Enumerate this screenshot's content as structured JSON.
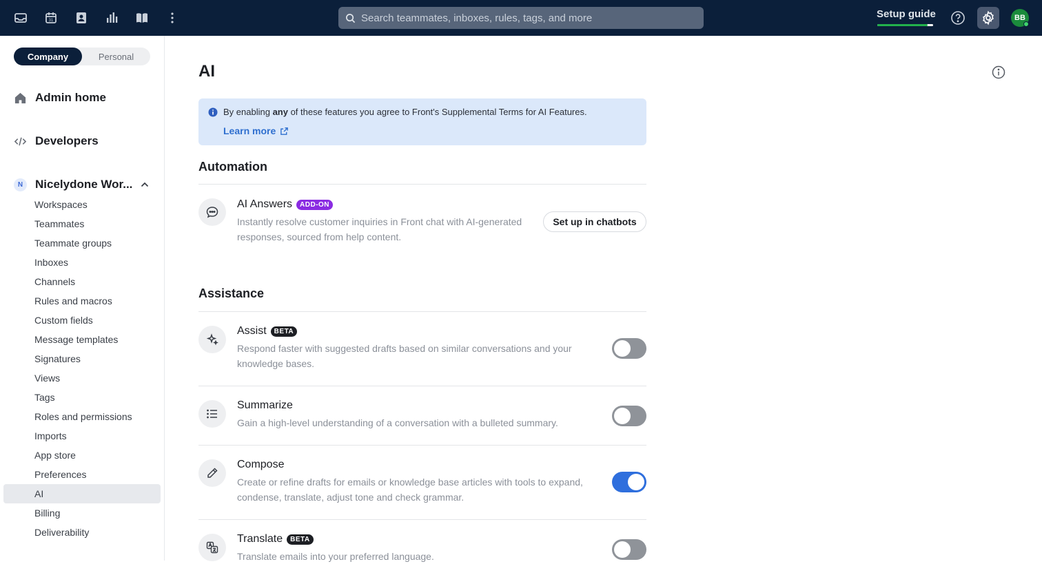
{
  "topbar": {
    "icons": [
      "inbox-icon",
      "calendar-icon",
      "contacts-icon",
      "analytics-icon",
      "knowledge-base-icon",
      "more-icon"
    ],
    "search_placeholder": "Search teammates, inboxes, rules, tags, and more",
    "setup_guide": "Setup guide",
    "setup_progress": 0.9,
    "avatar_initials": "BB"
  },
  "sidebar": {
    "seg_company": "Company",
    "seg_personal": "Personal",
    "admin_home": "Admin home",
    "developers": "Developers",
    "workspace_badge": "N",
    "workspace": "Nicelydone Wor...",
    "items": [
      "Workspaces",
      "Teammates",
      "Teammate groups",
      "Inboxes",
      "Channels",
      "Rules and macros",
      "Custom fields",
      "Message templates",
      "Signatures",
      "Views",
      "Tags",
      "Roles and permissions",
      "Imports",
      "App store",
      "Preferences",
      "AI",
      "Billing",
      "Deliverability"
    ],
    "active": "AI"
  },
  "main": {
    "title": "AI",
    "notice": {
      "prefix": "By enabling ",
      "bold": "any",
      "suffix": " of these features you agree to Front's Supplemental Terms for AI Features.",
      "link": "Learn more"
    },
    "automation": {
      "heading": "Automation",
      "ai_answers": {
        "title": "AI Answers",
        "badge": "ADD-ON",
        "desc": "Instantly resolve customer inquiries in Front chat with AI-generated responses, sourced from help content.",
        "button": "Set up in chatbots"
      }
    },
    "assistance": {
      "heading": "Assistance",
      "features": [
        {
          "title": "Assist",
          "badge": "BETA",
          "desc": "Respond faster with suggested drafts based on similar conversations and your knowledge bases.",
          "enabled": false
        },
        {
          "title": "Summarize",
          "badge": "",
          "desc": "Gain a high-level understanding of a conversation with a bulleted summary.",
          "enabled": false
        },
        {
          "title": "Compose",
          "badge": "",
          "desc": "Create or refine drafts for emails or knowledge base articles with tools to expand, condense, translate, adjust tone and check grammar.",
          "enabled": true
        },
        {
          "title": "Translate",
          "badge": "BETA",
          "desc": "Translate emails into your preferred language.",
          "enabled": false
        }
      ]
    }
  }
}
